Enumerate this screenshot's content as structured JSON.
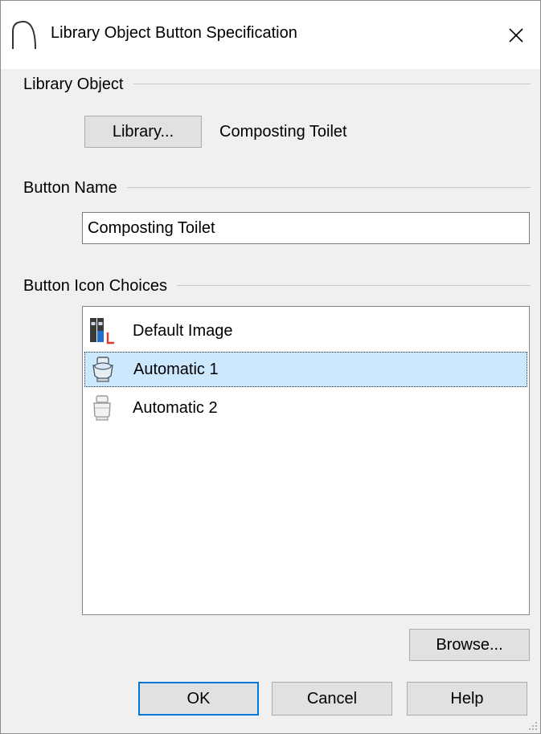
{
  "window": {
    "title": "Library Object Button Specification",
    "close_glyph": "✕"
  },
  "library_object": {
    "section_label": "Library Object",
    "library_button_label": "Library...",
    "object_name": "Composting Toilet"
  },
  "button_name": {
    "section_label": "Button Name",
    "value": "Composting Toilet"
  },
  "icon_choices": {
    "section_label": "Button Icon Choices",
    "items": [
      {
        "label": "Default Image",
        "icon": "library-books-icon",
        "selected": false
      },
      {
        "label": "Automatic 1",
        "icon": "toilet-icon",
        "selected": true
      },
      {
        "label": "Automatic 2",
        "icon": "toilet-gray-icon",
        "selected": false
      }
    ],
    "browse_label": "Browse..."
  },
  "footer": {
    "ok_label": "OK",
    "cancel_label": "Cancel",
    "help_label": "Help"
  },
  "colors": {
    "accent": "#0078d7",
    "selection": "#cce8ff",
    "dialog_bg": "#f0f0f0"
  }
}
